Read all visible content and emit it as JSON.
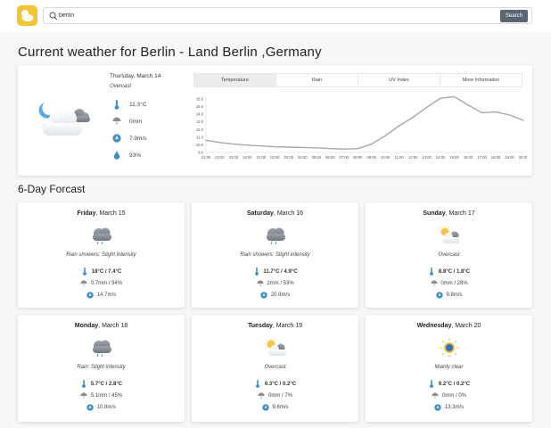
{
  "header": {
    "search_value": "berlin",
    "search_button_label": "Search"
  },
  "page_title": "Current weather for Berlin - Land Berlin ,Germany",
  "current": {
    "date": "Thursday, March 14",
    "description": "Overcast",
    "temperature": "11.3°C",
    "precipitation": "0mm",
    "wind": "7.9m/s",
    "humidity": "93%",
    "tabs": [
      "Temperature",
      "Rain",
      "UV Index",
      "More Information"
    ]
  },
  "chart_data": {
    "type": "line",
    "title": "",
    "xlabel": "",
    "ylabel": "",
    "x": [
      "21:00",
      "22:00",
      "23:00",
      "24:00",
      "01:00",
      "02:00",
      "03:00",
      "04:00",
      "05:00",
      "06:00",
      "07:00",
      "08:00",
      "09:00",
      "10:00",
      "11:00",
      "12:00",
      "13:00",
      "14:00",
      "15:00",
      "16:00",
      "17:00",
      "18:00",
      "19:00",
      "20:00"
    ],
    "y_ticks": [
      "9.0",
      "10.0",
      "11.0",
      "12.0",
      "13.0",
      "14.0",
      "15.0",
      "16.0"
    ],
    "ylim": [
      9.0,
      16.0
    ],
    "series": [
      {
        "color": "#a3a7b0",
        "values": [
          10.6,
          10.3,
          10.1,
          9.95,
          9.85,
          9.75,
          9.7,
          9.65,
          9.6,
          9.5,
          9.45,
          9.5,
          10.1,
          11.2,
          12.5,
          13.6,
          14.9,
          16.1,
          16.3,
          15.2,
          14.2,
          14.3,
          13.9,
          13.2
        ]
      }
    ],
    "grid": false
  },
  "forecast_title": "6-Day Forcast",
  "forecast": [
    {
      "day": "Friday",
      "date": "March 15",
      "icon": "rain-cloud-icon",
      "description": "Rain showers: Slight intensity",
      "temp": "18°C / 7.4°C",
      "precip": "0.7mm / 94%",
      "wind": "14.7m/s"
    },
    {
      "day": "Saturday",
      "date": "March 16",
      "icon": "rain-cloud-icon",
      "description": "Rain showers: Slight intensity",
      "temp": "11.7°C / 4.9°C",
      "precip": "2mm / 53%",
      "wind": "20.8m/s"
    },
    {
      "day": "Sunday",
      "date": "March 17",
      "icon": "sun-cloud-icon",
      "description": "Overcast",
      "temp": "8.8°C / 1.8°C",
      "precip": "0mm / 28%",
      "wind": "9.8m/s"
    },
    {
      "day": "Monday",
      "date": "March 18",
      "icon": "rain-cloud-icon",
      "description": "Rain: Slight intensity",
      "temp": "5.7°C / 2.8°C",
      "precip": "5.1mm / 45%",
      "wind": "10.8m/s"
    },
    {
      "day": "Tuesday",
      "date": "March 19",
      "icon": "sun-cloud-icon",
      "description": "Overcast",
      "temp": "6.3°C / 0.2°C",
      "precip": "0mm / 7%",
      "wind": "9.6m/s"
    },
    {
      "day": "Wednesday",
      "date": "March 20",
      "icon": "sun-icon",
      "description": "Mainly clear",
      "temp": "9.2°C / 0.2°C",
      "precip": "0mm / 0%",
      "wind": "13.3m/s"
    }
  ],
  "colors": {
    "accent": "#f4c430",
    "button": "#5b6674",
    "chart_line": "#a3a7b0",
    "icon_blue": "#3f8fc7"
  }
}
